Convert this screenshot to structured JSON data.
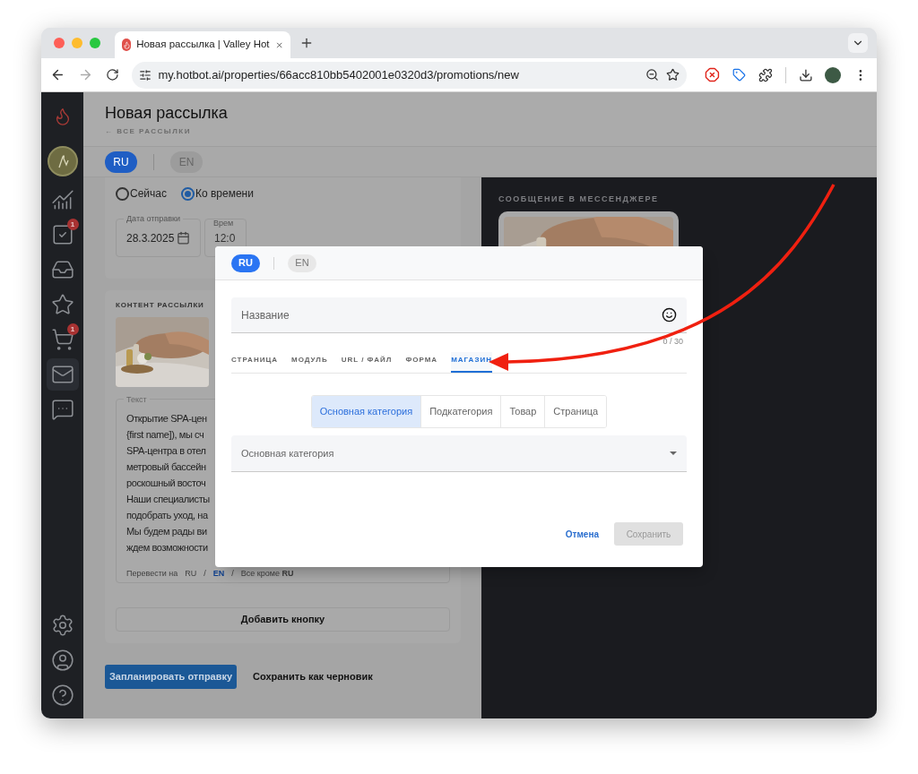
{
  "browser": {
    "tab_title": "Новая рассылка | Valley Hot",
    "url": "my.hotbot.ai/properties/66acc810bb5402001e0320d3/promotions/new"
  },
  "sidebar": {
    "top_items": [
      {
        "kind": "chart",
        "selected": false
      },
      {
        "kind": "tasks",
        "selected": false,
        "badge": "1"
      },
      {
        "kind": "inbox",
        "selected": false
      },
      {
        "kind": "reviews",
        "selected": false
      },
      {
        "kind": "cart",
        "selected": false,
        "badge": "1"
      },
      {
        "kind": "mail",
        "selected": true
      },
      {
        "kind": "chat",
        "selected": false
      }
    ],
    "bottom_items": [
      {
        "kind": "settings",
        "selected": false
      },
      {
        "kind": "profile",
        "selected": false
      },
      {
        "kind": "help",
        "selected": false
      }
    ]
  },
  "page": {
    "title": "Новая рассылка",
    "back_link": "← ВСЕ РАССЫЛКИ",
    "languages": [
      {
        "label": "RU",
        "selected": true
      },
      {
        "label": "EN",
        "selected": false
      }
    ],
    "send_options": [
      {
        "label": "Сейчас",
        "selected": false
      },
      {
        "label": "Ко времени",
        "selected": true
      }
    ],
    "date_field": {
      "label": "Дата отправки",
      "value": "28.3.2025"
    },
    "time_field": {
      "label": "Врем",
      "value": "12:0"
    },
    "content": {
      "title": "КОНТЕНТ РАССЫЛКИ",
      "text_label": "Текст",
      "text_lines": [
        "Открытие SPA-цен",
        "{first name]), мы сч",
        "SPA-центра в отел",
        "метровый бассейн",
        "роскошный восточ",
        "Наши специалисты",
        "подобрать уход, на",
        "Мы будем рады ви",
        "ждем возможности"
      ],
      "translate_label": "Перевести на",
      "separator": "/",
      "translate_options": [
        {
          "label": "RU",
          "selected": false
        },
        {
          "label": "EN",
          "selected": true
        },
        {
          "label": "Все кроме **RU**",
          "selected": false
        }
      ],
      "add_button": "Добавить кнопку"
    },
    "schedule_button": "Запланировать отправку",
    "draft_button": "Сохранить как черновик",
    "preview": {
      "title": "СООБЩЕНИЕ В МЕССЕНДЖЕРЕ"
    }
  },
  "dialog": {
    "languages": [
      {
        "label": "RU",
        "selected": true
      },
      {
        "label": "EN",
        "selected": false
      }
    ],
    "name_field": {
      "placeholder": "Название",
      "counter": "0 / 30"
    },
    "tabs": [
      {
        "label": "СТРАНИЦА",
        "selected": false
      },
      {
        "label": "МОДУЛЬ",
        "selected": false
      },
      {
        "label": "URL / ФАЙЛ",
        "selected": false
      },
      {
        "label": "ФОРМА",
        "selected": false
      },
      {
        "label": "МАГАЗИН",
        "selected": true
      }
    ],
    "segments": [
      {
        "label": "Основная категория",
        "selected": true
      },
      {
        "label": "Подкатегория",
        "selected": false
      },
      {
        "label": "Товар",
        "selected": false
      },
      {
        "label": "Страница",
        "selected": false
      }
    ],
    "select": {
      "placeholder": "Основная категория"
    },
    "cancel_button": "Отмена",
    "save_button": {
      "label": "Сохранить",
      "disabled": true
    }
  }
}
